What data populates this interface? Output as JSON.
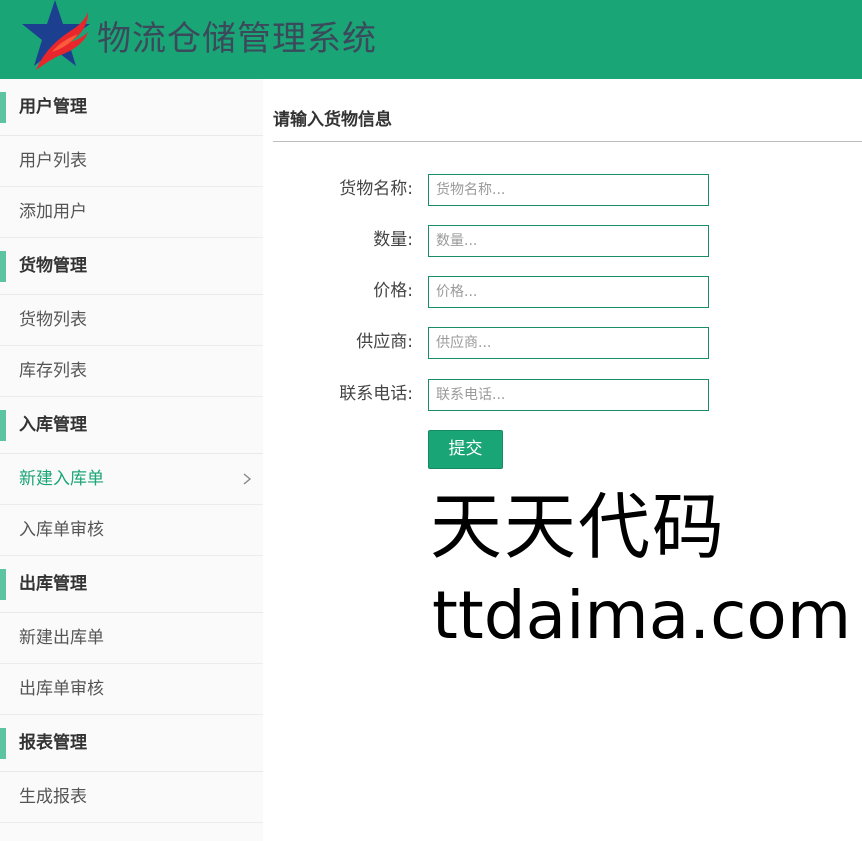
{
  "header": {
    "title": "物流仓储管理系统",
    "logo_icon": "star-flame-logo-icon",
    "background_color": "#1aa577"
  },
  "sidebar": {
    "groups": [
      {
        "label": "用户管理",
        "items": [
          {
            "label": "用户列表"
          },
          {
            "label": "添加用户"
          }
        ]
      },
      {
        "label": "货物管理",
        "items": [
          {
            "label": "货物列表"
          },
          {
            "label": "库存列表"
          }
        ]
      },
      {
        "label": "入库管理",
        "items": [
          {
            "label": "新建入库单",
            "active": true
          },
          {
            "label": "入库单审核"
          }
        ]
      },
      {
        "label": "出库管理",
        "items": [
          {
            "label": "新建出库单"
          },
          {
            "label": "出库单审核"
          }
        ]
      },
      {
        "label": "报表管理",
        "items": [
          {
            "label": "生成报表"
          }
        ]
      }
    ],
    "accent_color": "#5cc4a0",
    "active_color": "#1aa577"
  },
  "form": {
    "title": "请输入货物信息",
    "fields": [
      {
        "label": "货物名称:",
        "placeholder": "货物名称...",
        "value": ""
      },
      {
        "label": "数量:",
        "placeholder": "数量...",
        "value": ""
      },
      {
        "label": "价格:",
        "placeholder": "价格...",
        "value": ""
      },
      {
        "label": "供应商:",
        "placeholder": "供应商...",
        "value": ""
      },
      {
        "label": "联系电话:",
        "placeholder": "联系电话...",
        "value": ""
      }
    ],
    "submit_label": "提交"
  },
  "watermark": {
    "line1": "天天代码",
    "line2": "ttdaima.com"
  }
}
